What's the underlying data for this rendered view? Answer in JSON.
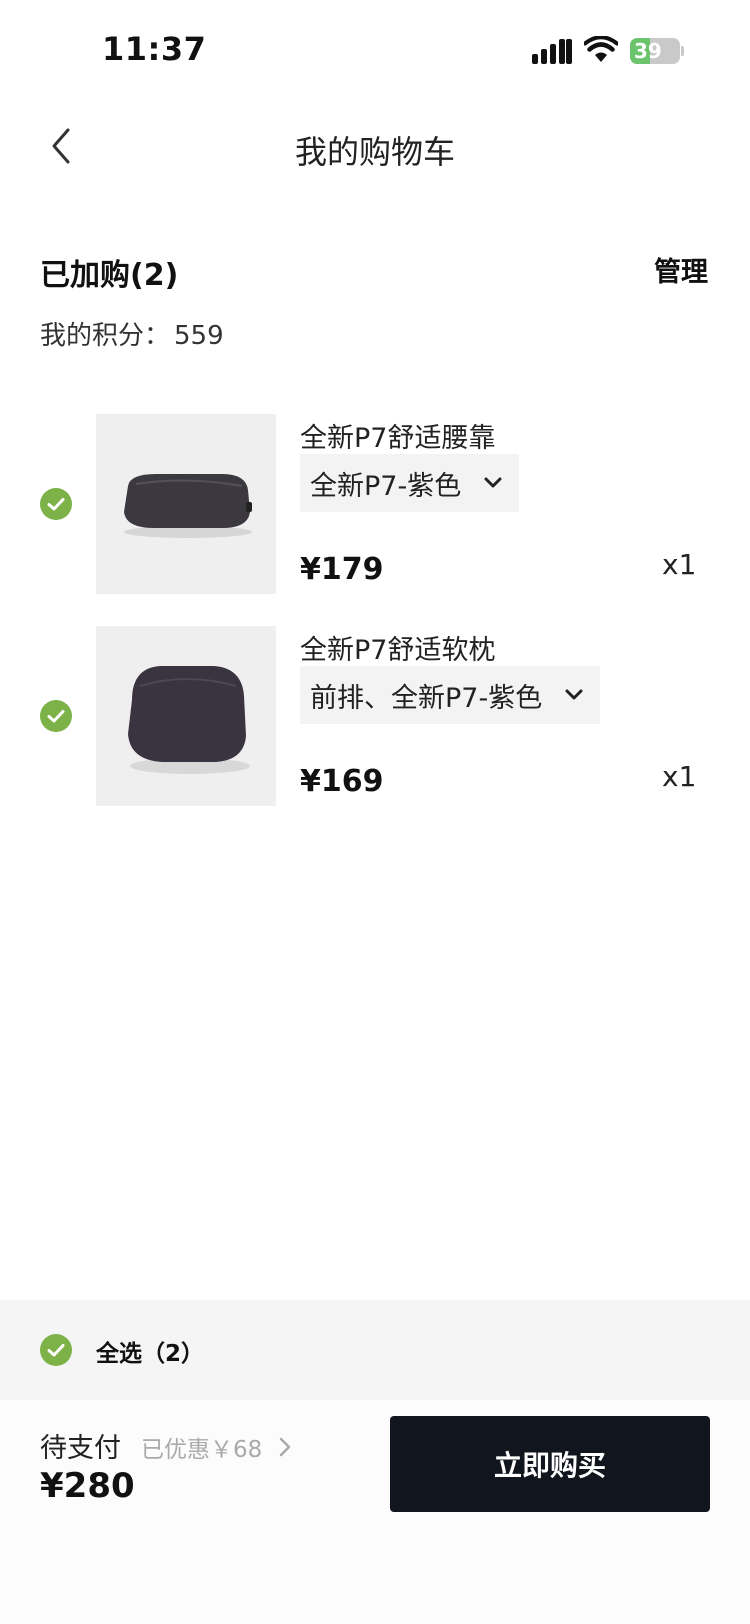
{
  "status_bar": {
    "time": "11:37",
    "battery": "39",
    "battery_level": 0.39
  },
  "nav": {
    "title": "我的购物车"
  },
  "header": {
    "cart_count": "已加购(2)",
    "manage_label": "管理",
    "points_label": "我的积分：",
    "points_value": "559"
  },
  "items": [
    {
      "name": "全新P7舒适腰靠",
      "variant": "全新P7-紫色",
      "price": "¥179",
      "qty": "x1",
      "selected": true,
      "product_color": "#3b3840"
    },
    {
      "name": "全新P7舒适软枕",
      "variant": "前排、全新P7-紫色",
      "price": "¥169",
      "qty": "x1",
      "selected": true,
      "product_color": "#3a3440"
    }
  ],
  "select_all": {
    "label": "全选（2）",
    "selected": true
  },
  "footer": {
    "pay_label": "待支付",
    "discount_label": "已优惠￥68",
    "total": "¥280",
    "buy_label": "立即购买"
  },
  "colors": {
    "check_green": "#7db249",
    "buy_button": "#11151e",
    "select_bar_bg": "#f5f5f5"
  },
  "icons": {
    "back": "chevron-left-icon",
    "check": "check-circle-icon",
    "dropdown": "chevron-down-icon",
    "discount_more": "chevron-right-icon"
  }
}
